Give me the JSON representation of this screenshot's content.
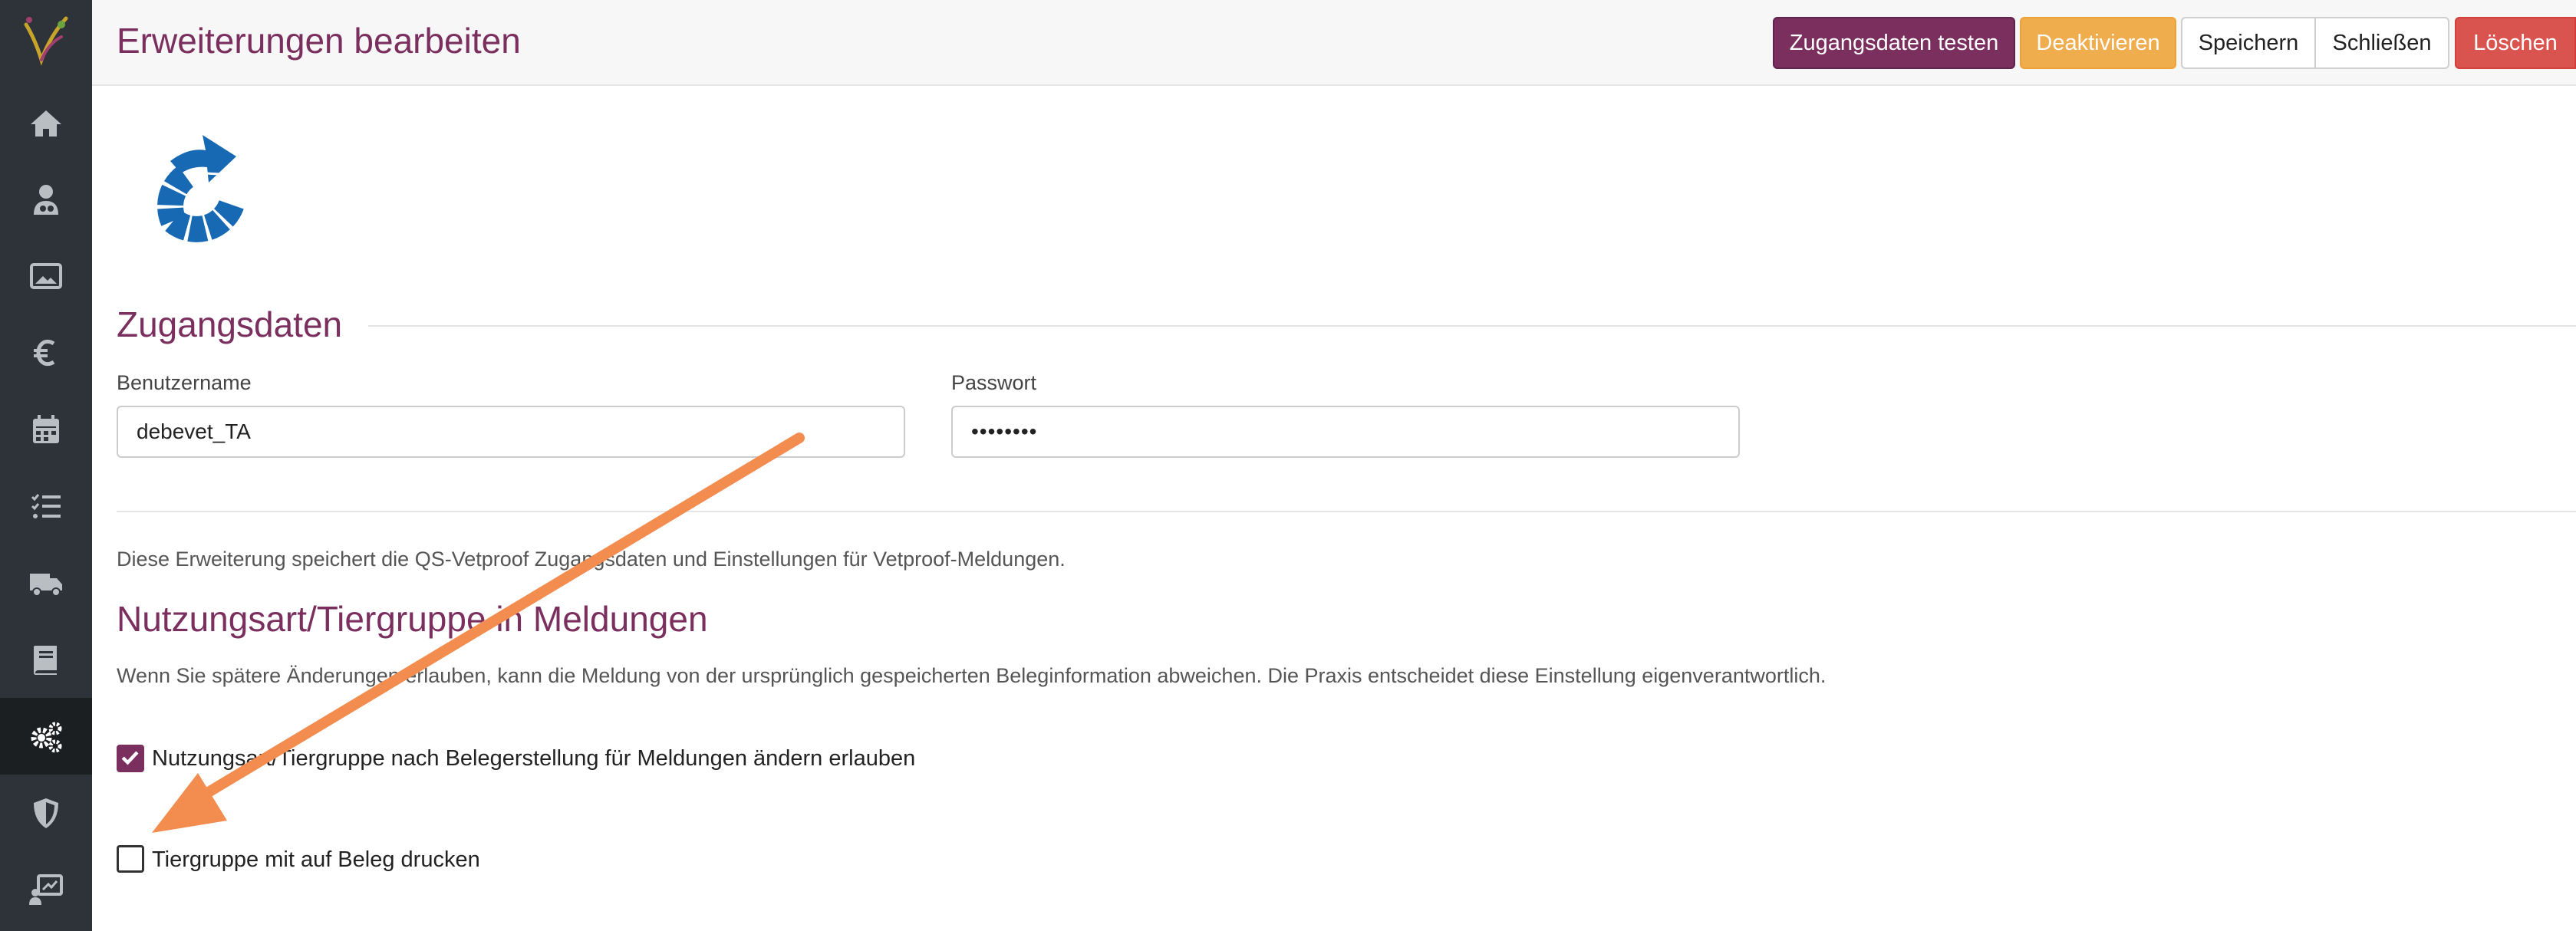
{
  "header": {
    "title": "Erweiterungen bearbeiten",
    "buttons": {
      "test": "Zugangsdaten testen",
      "deactivate": "Deaktivieren",
      "save": "Speichern",
      "close": "Schließen",
      "delete": "Löschen"
    }
  },
  "sidebar": {
    "items": [
      {
        "icon": "home-icon"
      },
      {
        "icon": "doctor-icon"
      },
      {
        "icon": "image-icon"
      },
      {
        "icon": "euro-icon"
      },
      {
        "icon": "calendar-icon"
      },
      {
        "icon": "checklist-icon"
      },
      {
        "icon": "truck-icon"
      },
      {
        "icon": "book-icon"
      },
      {
        "icon": "gears-icon",
        "active": true
      },
      {
        "icon": "shield-icon"
      },
      {
        "icon": "presentation-icon"
      }
    ]
  },
  "credentials": {
    "title": "Zugangsdaten",
    "username_label": "Benutzername",
    "username_value": "debevet_TA",
    "password_label": "Passwort",
    "password_value": "••••••••"
  },
  "description": "Diese Erweiterung speichert die QS-Vetproof Zugangsdaten und Einstellungen für Vetproof-Meldungen.",
  "usage": {
    "title": "Nutzungsart/Tiergruppe in Meldungen",
    "info": "Wenn Sie spätere Änderungen erlauben, kann die Meldung von der ursprünglich gespeicherten Beleginformation abweichen. Die Praxis entscheidet diese Einstellung eigenverantwortlich.",
    "options": [
      {
        "label": "Nutzungsart/Tiergruppe nach Belegerstellung für Meldungen ändern erlauben",
        "checked": true
      },
      {
        "label": "Tiergruppe mit auf Beleg drucken",
        "checked": false
      }
    ]
  },
  "colors": {
    "accent": "#7a2f5f",
    "warning": "#f0ad4e",
    "danger": "#d9534f",
    "sidebar": "#2d3338",
    "annotation_arrow": "#f28c4f",
    "extension_icon": "#1769b3"
  }
}
